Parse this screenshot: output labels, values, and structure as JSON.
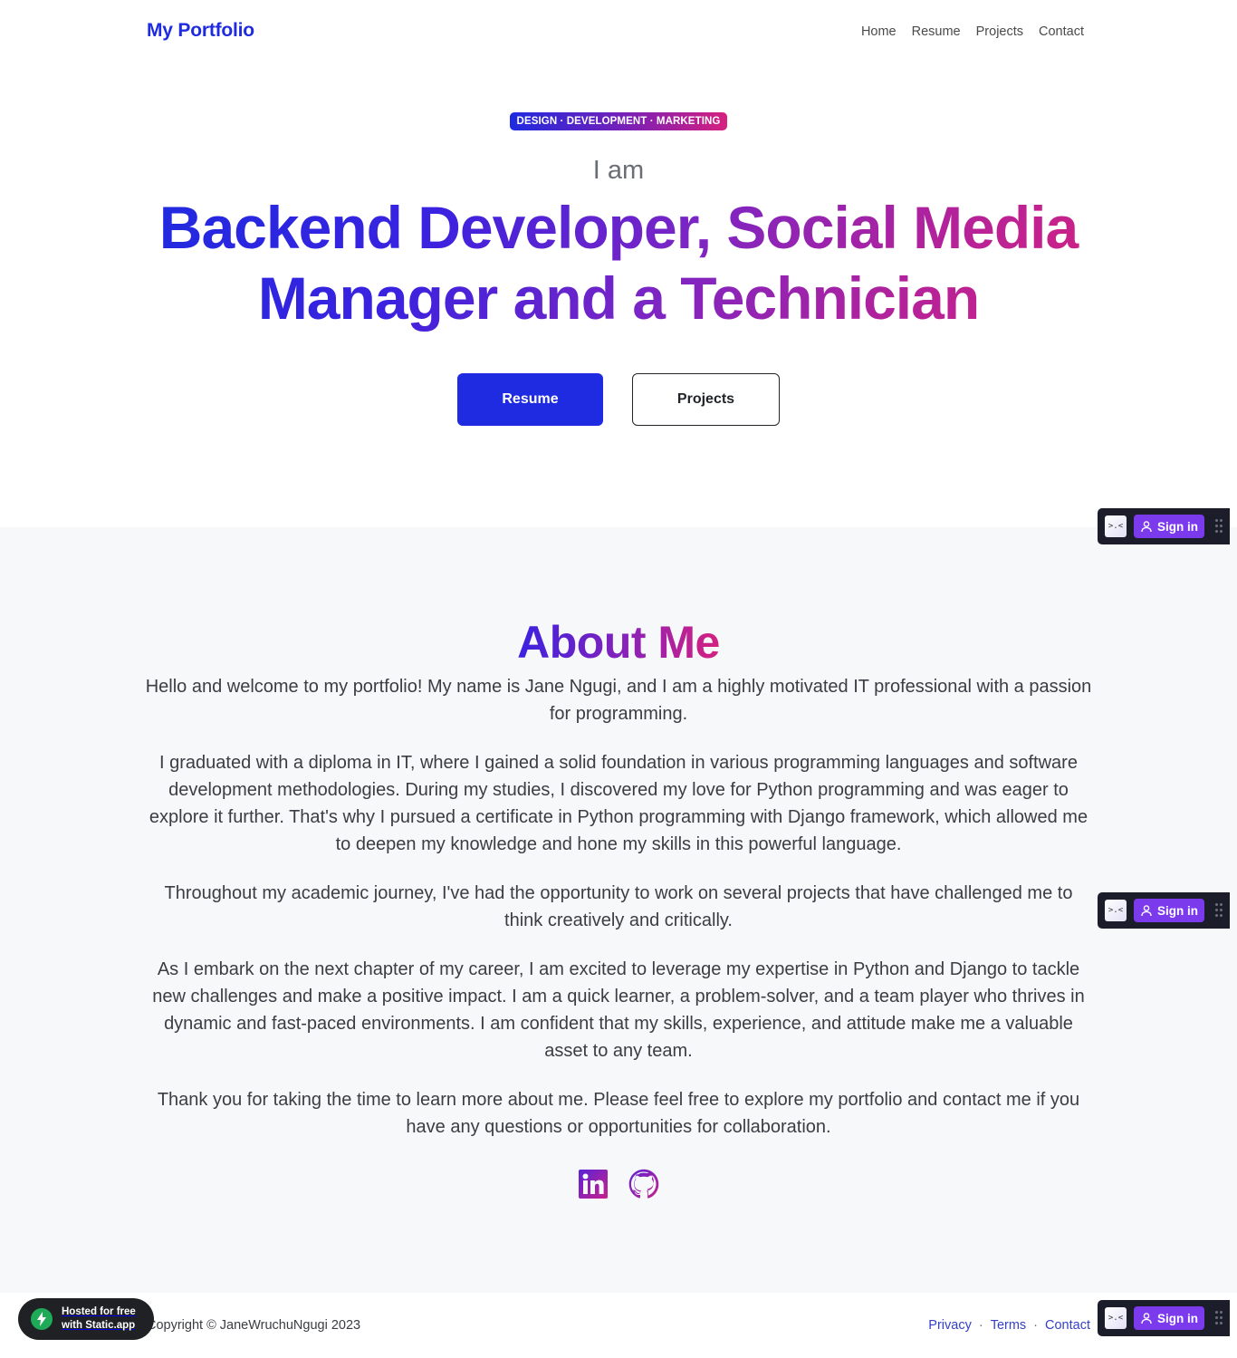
{
  "nav": {
    "brand": "My Portfolio",
    "links": [
      "Home",
      "Resume",
      "Projects",
      "Contact"
    ]
  },
  "hero": {
    "badge": "DESIGN · DEVELOPMENT · MARKETING",
    "intro": "I am",
    "headline": "Backend Developer, Social Media Manager and a Technician",
    "primary_button": "Resume",
    "secondary_button": "Projects"
  },
  "about": {
    "title": "About Me",
    "paragraphs": [
      "Hello and welcome to my portfolio! My name is Jane Ngugi, and I am a highly motivated IT professional with a passion for programming.",
      "I graduated with a diploma in IT, where I gained a solid foundation in various programming languages and software development methodologies. During my studies, I discovered my love for Python programming and was eager to explore it further. That's why I pursued a certificate in Python programming with Django framework, which allowed me to deepen my knowledge and hone my skills in this powerful language.",
      "Throughout my academic journey, I've had the opportunity to work on several projects that have challenged me to think creatively and critically.",
      "As I embark on the next chapter of my career, I am excited to leverage my expertise in Python and Django to tackle new challenges and make a positive impact. I am a quick learner, a problem-solver, and a team player who thrives in dynamic and fast-paced environments. I am confident that my skills, experience, and attitude make me a valuable asset to any team.",
      "Thank you for taking the time to learn more about me. Please feel free to explore my portfolio and contact me if you have any questions or opportunities for collaboration."
    ],
    "social_icons": [
      "linkedin-icon",
      "github-icon"
    ]
  },
  "footer": {
    "copyright": "Copyright © JaneWruchuNgugi 2023",
    "links": [
      "Privacy",
      "Terms",
      "Contact"
    ],
    "separator": "·"
  },
  "static_badge": {
    "line1": "Hosted for free",
    "line2": "with Static.app"
  },
  "widget": {
    "face": ">.<",
    "signin_label": "Sign in"
  },
  "colors": {
    "brand_blue": "#1e2be0",
    "accent_purple": "#7b25c4",
    "accent_pink": "#d6217f",
    "widget_purple": "#7c3aed"
  }
}
